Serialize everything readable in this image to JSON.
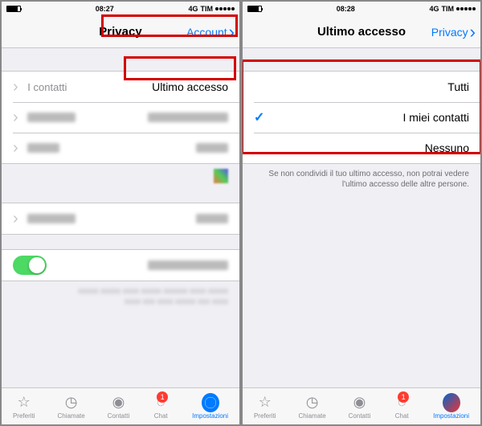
{
  "statusBar": {
    "carrier": "TIM",
    "network": "4G",
    "timeLeft": "08:27",
    "timeRight": "08:28"
  },
  "screenLeft": {
    "navBack": "Account",
    "navTitle": "Privacy",
    "rows": {
      "lastSeen": {
        "label": "Ultimo accesso",
        "value": "I contatti"
      }
    },
    "tabs": {
      "favorites": "Preferiti",
      "calls": "Chiamate",
      "contacts": "Contatti",
      "chat": "Chat",
      "settings": "Impostazioni",
      "chatBadge": "1"
    }
  },
  "screenRight": {
    "navBack": "Privacy",
    "navTitle": "Ultimo accesso",
    "options": {
      "everyone": "Tutti",
      "contacts": "I miei contatti",
      "nobody": "Nessuno"
    },
    "footerNote": "Se non condividi il tuo ultimo accesso, non potrai vedere l'ultimo accesso delle altre persone.",
    "tabs": {
      "favorites": "Preferiti",
      "calls": "Chiamate",
      "contacts": "Contatti",
      "chat": "Chat",
      "settings": "Impostazioni",
      "chatBadge": "1"
    }
  }
}
